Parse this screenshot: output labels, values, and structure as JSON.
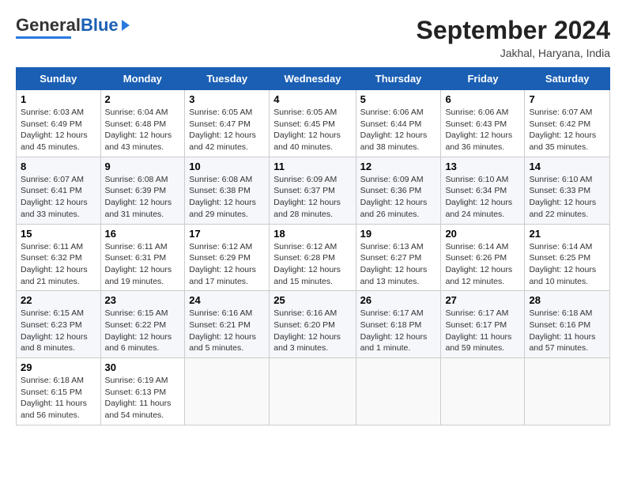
{
  "header": {
    "logo_general": "General",
    "logo_blue": "Blue",
    "month_title": "September 2024",
    "location": "Jakhal, Haryana, India"
  },
  "columns": [
    "Sunday",
    "Monday",
    "Tuesday",
    "Wednesday",
    "Thursday",
    "Friday",
    "Saturday"
  ],
  "weeks": [
    [
      {
        "day": "1",
        "sunrise": "Sunrise: 6:03 AM",
        "sunset": "Sunset: 6:49 PM",
        "daylight": "Daylight: 12 hours and 45 minutes."
      },
      {
        "day": "2",
        "sunrise": "Sunrise: 6:04 AM",
        "sunset": "Sunset: 6:48 PM",
        "daylight": "Daylight: 12 hours and 43 minutes."
      },
      {
        "day": "3",
        "sunrise": "Sunrise: 6:05 AM",
        "sunset": "Sunset: 6:47 PM",
        "daylight": "Daylight: 12 hours and 42 minutes."
      },
      {
        "day": "4",
        "sunrise": "Sunrise: 6:05 AM",
        "sunset": "Sunset: 6:45 PM",
        "daylight": "Daylight: 12 hours and 40 minutes."
      },
      {
        "day": "5",
        "sunrise": "Sunrise: 6:06 AM",
        "sunset": "Sunset: 6:44 PM",
        "daylight": "Daylight: 12 hours and 38 minutes."
      },
      {
        "day": "6",
        "sunrise": "Sunrise: 6:06 AM",
        "sunset": "Sunset: 6:43 PM",
        "daylight": "Daylight: 12 hours and 36 minutes."
      },
      {
        "day": "7",
        "sunrise": "Sunrise: 6:07 AM",
        "sunset": "Sunset: 6:42 PM",
        "daylight": "Daylight: 12 hours and 35 minutes."
      }
    ],
    [
      {
        "day": "8",
        "sunrise": "Sunrise: 6:07 AM",
        "sunset": "Sunset: 6:41 PM",
        "daylight": "Daylight: 12 hours and 33 minutes."
      },
      {
        "day": "9",
        "sunrise": "Sunrise: 6:08 AM",
        "sunset": "Sunset: 6:39 PM",
        "daylight": "Daylight: 12 hours and 31 minutes."
      },
      {
        "day": "10",
        "sunrise": "Sunrise: 6:08 AM",
        "sunset": "Sunset: 6:38 PM",
        "daylight": "Daylight: 12 hours and 29 minutes."
      },
      {
        "day": "11",
        "sunrise": "Sunrise: 6:09 AM",
        "sunset": "Sunset: 6:37 PM",
        "daylight": "Daylight: 12 hours and 28 minutes."
      },
      {
        "day": "12",
        "sunrise": "Sunrise: 6:09 AM",
        "sunset": "Sunset: 6:36 PM",
        "daylight": "Daylight: 12 hours and 26 minutes."
      },
      {
        "day": "13",
        "sunrise": "Sunrise: 6:10 AM",
        "sunset": "Sunset: 6:34 PM",
        "daylight": "Daylight: 12 hours and 24 minutes."
      },
      {
        "day": "14",
        "sunrise": "Sunrise: 6:10 AM",
        "sunset": "Sunset: 6:33 PM",
        "daylight": "Daylight: 12 hours and 22 minutes."
      }
    ],
    [
      {
        "day": "15",
        "sunrise": "Sunrise: 6:11 AM",
        "sunset": "Sunset: 6:32 PM",
        "daylight": "Daylight: 12 hours and 21 minutes."
      },
      {
        "day": "16",
        "sunrise": "Sunrise: 6:11 AM",
        "sunset": "Sunset: 6:31 PM",
        "daylight": "Daylight: 12 hours and 19 minutes."
      },
      {
        "day": "17",
        "sunrise": "Sunrise: 6:12 AM",
        "sunset": "Sunset: 6:29 PM",
        "daylight": "Daylight: 12 hours and 17 minutes."
      },
      {
        "day": "18",
        "sunrise": "Sunrise: 6:12 AM",
        "sunset": "Sunset: 6:28 PM",
        "daylight": "Daylight: 12 hours and 15 minutes."
      },
      {
        "day": "19",
        "sunrise": "Sunrise: 6:13 AM",
        "sunset": "Sunset: 6:27 PM",
        "daylight": "Daylight: 12 hours and 13 minutes."
      },
      {
        "day": "20",
        "sunrise": "Sunrise: 6:14 AM",
        "sunset": "Sunset: 6:26 PM",
        "daylight": "Daylight: 12 hours and 12 minutes."
      },
      {
        "day": "21",
        "sunrise": "Sunrise: 6:14 AM",
        "sunset": "Sunset: 6:25 PM",
        "daylight": "Daylight: 12 hours and 10 minutes."
      }
    ],
    [
      {
        "day": "22",
        "sunrise": "Sunrise: 6:15 AM",
        "sunset": "Sunset: 6:23 PM",
        "daylight": "Daylight: 12 hours and 8 minutes."
      },
      {
        "day": "23",
        "sunrise": "Sunrise: 6:15 AM",
        "sunset": "Sunset: 6:22 PM",
        "daylight": "Daylight: 12 hours and 6 minutes."
      },
      {
        "day": "24",
        "sunrise": "Sunrise: 6:16 AM",
        "sunset": "Sunset: 6:21 PM",
        "daylight": "Daylight: 12 hours and 5 minutes."
      },
      {
        "day": "25",
        "sunrise": "Sunrise: 6:16 AM",
        "sunset": "Sunset: 6:20 PM",
        "daylight": "Daylight: 12 hours and 3 minutes."
      },
      {
        "day": "26",
        "sunrise": "Sunrise: 6:17 AM",
        "sunset": "Sunset: 6:18 PM",
        "daylight": "Daylight: 12 hours and 1 minute."
      },
      {
        "day": "27",
        "sunrise": "Sunrise: 6:17 AM",
        "sunset": "Sunset: 6:17 PM",
        "daylight": "Daylight: 11 hours and 59 minutes."
      },
      {
        "day": "28",
        "sunrise": "Sunrise: 6:18 AM",
        "sunset": "Sunset: 6:16 PM",
        "daylight": "Daylight: 11 hours and 57 minutes."
      }
    ],
    [
      {
        "day": "29",
        "sunrise": "Sunrise: 6:18 AM",
        "sunset": "Sunset: 6:15 PM",
        "daylight": "Daylight: 11 hours and 56 minutes."
      },
      {
        "day": "30",
        "sunrise": "Sunrise: 6:19 AM",
        "sunset": "Sunset: 6:13 PM",
        "daylight": "Daylight: 11 hours and 54 minutes."
      },
      null,
      null,
      null,
      null,
      null
    ]
  ]
}
